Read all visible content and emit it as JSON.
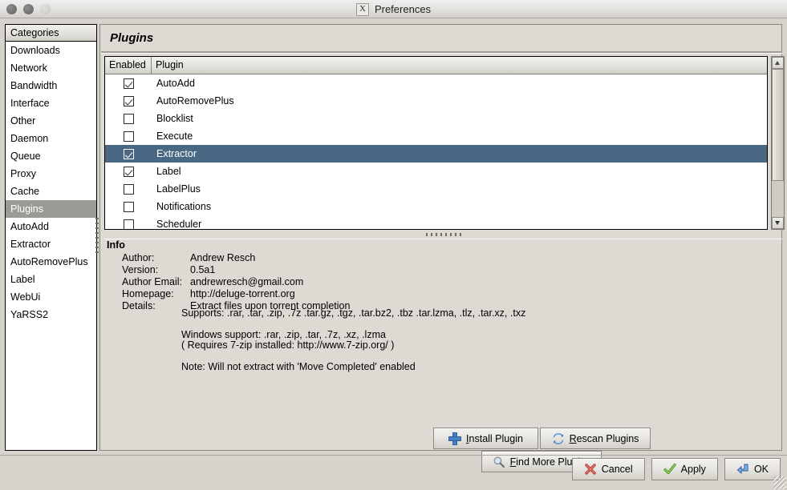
{
  "window": {
    "title": "Preferences",
    "icon": "x-window-icon",
    "controls": [
      "close-button",
      "minimize-button",
      "maximize-button"
    ]
  },
  "sidebar": {
    "header": "Categories",
    "selected": "Plugins",
    "items": [
      {
        "label": "Downloads"
      },
      {
        "label": "Network"
      },
      {
        "label": "Bandwidth"
      },
      {
        "label": "Interface"
      },
      {
        "label": "Other"
      },
      {
        "label": "Daemon"
      },
      {
        "label": "Queue"
      },
      {
        "label": "Proxy"
      },
      {
        "label": "Cache"
      },
      {
        "label": "Plugins"
      },
      {
        "label": "AutoAdd"
      },
      {
        "label": "Extractor"
      },
      {
        "label": "AutoRemovePlus"
      },
      {
        "label": "Label"
      },
      {
        "label": "WebUi"
      },
      {
        "label": "YaRSS2"
      }
    ]
  },
  "main": {
    "heading": "Plugins",
    "table": {
      "columns": [
        "Enabled",
        "Plugin"
      ],
      "rows": [
        {
          "enabled": true,
          "name": "AutoAdd",
          "selected": false
        },
        {
          "enabled": true,
          "name": "AutoRemovePlus",
          "selected": false
        },
        {
          "enabled": false,
          "name": "Blocklist",
          "selected": false
        },
        {
          "enabled": false,
          "name": "Execute",
          "selected": false
        },
        {
          "enabled": true,
          "name": "Extractor",
          "selected": true
        },
        {
          "enabled": true,
          "name": "Label",
          "selected": false
        },
        {
          "enabled": false,
          "name": "LabelPlus",
          "selected": false
        },
        {
          "enabled": false,
          "name": "Notifications",
          "selected": false
        },
        {
          "enabled": false,
          "name": "Scheduler",
          "selected": false
        }
      ]
    },
    "info": {
      "title": "Info",
      "fields": [
        {
          "key": "Author:",
          "value": "Andrew Resch"
        },
        {
          "key": "Version:",
          "value": "0.5a1"
        },
        {
          "key": "Author Email:",
          "value": "andrewresch@gmail.com"
        },
        {
          "key": "Homepage:",
          "value": "http://deluge-torrent.org"
        },
        {
          "key": "Details:",
          "value": "Extract files upon torrent completion"
        }
      ],
      "description": {
        "supports": "Supports: .rar, .tar, .zip, .7z .tar.gz, .tgz, .tar.bz2, .tbz .tar.lzma, .tlz, .tar.xz, .txz",
        "windows_line1": "Windows support: .rar, .zip, .tar, .7z, .xz, .lzma",
        "windows_line2": "( Requires 7-zip installed: http://www.7-zip.org/ )",
        "note": "Note: Will not extract with 'Move Completed' enabled"
      }
    },
    "buttons": {
      "install": {
        "mnemonic": "I",
        "rest": "nstall Plugin",
        "icon": "plus-icon"
      },
      "rescan": {
        "mnemonic": "R",
        "rest": "escan Plugins",
        "icon": "refresh-icon"
      },
      "find_more": {
        "mnemonic": "F",
        "rest": "ind More Plugins",
        "icon": "search-icon"
      }
    }
  },
  "footer": {
    "cancel": {
      "mnemonic": "C",
      "rest": "ancel",
      "icon": "cancel-x-icon"
    },
    "apply": {
      "mnemonic": "A",
      "rest": "pply",
      "icon": "checkmark-icon"
    },
    "ok": {
      "mnemonic": "",
      "rest": "OK",
      "icon": "enter-arrow-icon"
    }
  },
  "colors": {
    "selection": "#4a6883",
    "sidebar_selection": "#9a9a96",
    "panel_bg": "#dddad3",
    "accent_blue": "#4b7fc4"
  }
}
